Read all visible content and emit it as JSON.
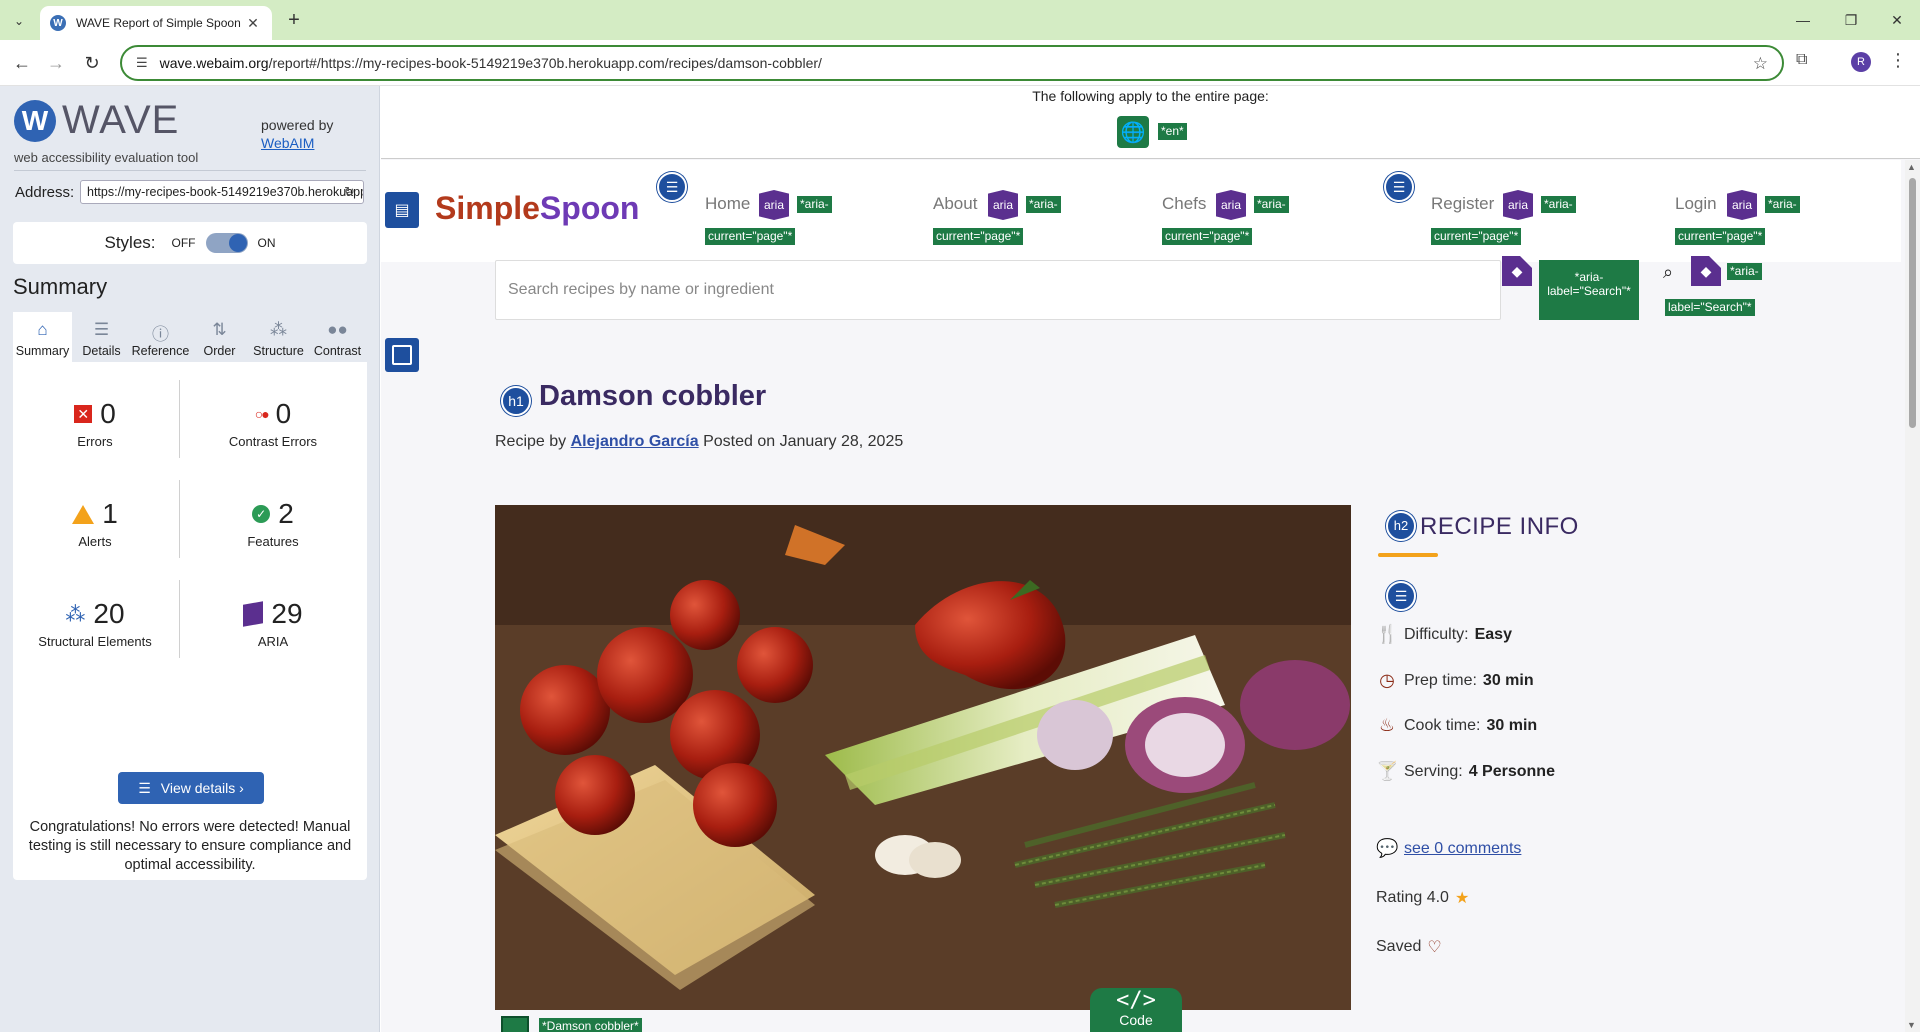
{
  "browser": {
    "tab_title": "WAVE Report of Simple Spoon",
    "favicon_letter": "W",
    "url_host": "wave.webaim.org",
    "url_path": "/report#/https://my-recipes-book-5149219e370b.herokuapp.com/recipes/damson-cobbler/",
    "profile_initial": "R"
  },
  "wave": {
    "logo_letter": "W",
    "brand": "WAVE",
    "tagline": "web accessibility evaluation tool",
    "powered_by": "powered by",
    "webaim": "WebAIM",
    "address_label": "Address:",
    "address_value": "https://my-recipes-book-5149219e370b.herokuapp.com/recipes/damson-cobbler/",
    "styles_label": "Styles:",
    "styles_off": "OFF",
    "styles_on": "ON",
    "styles_state": "on",
    "summary_title": "Summary",
    "tabs": [
      {
        "label": "Summary",
        "icon": "home-icon"
      },
      {
        "label": "Details",
        "icon": "list-icon"
      },
      {
        "label": "Reference",
        "icon": "info-icon"
      },
      {
        "label": "Order",
        "icon": "order-icon"
      },
      {
        "label": "Structure",
        "icon": "structure-icon"
      },
      {
        "label": "Contrast",
        "icon": "contrast-icon"
      }
    ],
    "active_tab": "Summary",
    "stats": {
      "errors": {
        "value": "0",
        "label": "Errors"
      },
      "contrast_errors": {
        "value": "0",
        "label": "Contrast Errors"
      },
      "alerts": {
        "value": "1",
        "label": "Alerts"
      },
      "features": {
        "value": "2",
        "label": "Features"
      },
      "structural": {
        "value": "20",
        "label": "Structural Elements"
      },
      "aria": {
        "value": "29",
        "label": "ARIA"
      }
    },
    "view_details": "View details ›",
    "congrats": "Congratulations! No errors were detected! Manual testing is still necessary to ensure compliance and optimal accessibility."
  },
  "page": {
    "applies_text": "The following apply to the entire page:",
    "lang_tag": "*en*",
    "site_name_a": "Simple",
    "site_name_b": "Spoon",
    "aria_label": "aria",
    "nav": [
      {
        "label": "Home",
        "tag1": "*aria-",
        "tag2": "current=\"page\"*"
      },
      {
        "label": "About",
        "tag1": "*aria-",
        "tag2": "current=\"page\"*"
      },
      {
        "label": "Chefs",
        "tag1": "*aria-",
        "tag2": "current=\"page\"*"
      },
      {
        "label": "Register",
        "tag1": "*aria-",
        "tag2": "current=\"page\"*"
      },
      {
        "label": "Login",
        "tag1": "*aria-",
        "tag2": "current=\"page\"*"
      }
    ],
    "search_placeholder": "Search recipes by name or ingredient",
    "search_btn_tag1": "*aria-",
    "search_btn_tag2": "label=\"Search\"*",
    "search_tag1": "*aria-",
    "search_tag2": "label=\"Search\"*",
    "h1_badge": "h1",
    "recipe_title": "Damson cobbler",
    "byline_prefix": "Recipe by ",
    "author": "Alejandro García",
    "posted": "Posted on January 28, 2025",
    "h2_badge": "h2",
    "info_title": "RECIPE INFO",
    "difficulty_label": "Difficulty:",
    "difficulty_value": "Easy",
    "prep_label": "Prep time:",
    "prep_value": "30 min",
    "cook_label": "Cook time:",
    "cook_value": "30 min",
    "serving_label": "Serving:",
    "serving_value": "4 Personne",
    "comments_link": "see 0 comments",
    "rating_label": "Rating 4.0",
    "saved_label": "Saved",
    "code_symbol": "</>",
    "code_label": "Code",
    "bottom_tag": "*Damson cobbler*"
  },
  "colors": {
    "wave_blue": "#2f63b3",
    "feature_green": "#1e7a45",
    "aria_purple": "#5b2f8f",
    "error_red": "#d9261c",
    "alert_orange": "#f3a21b"
  }
}
